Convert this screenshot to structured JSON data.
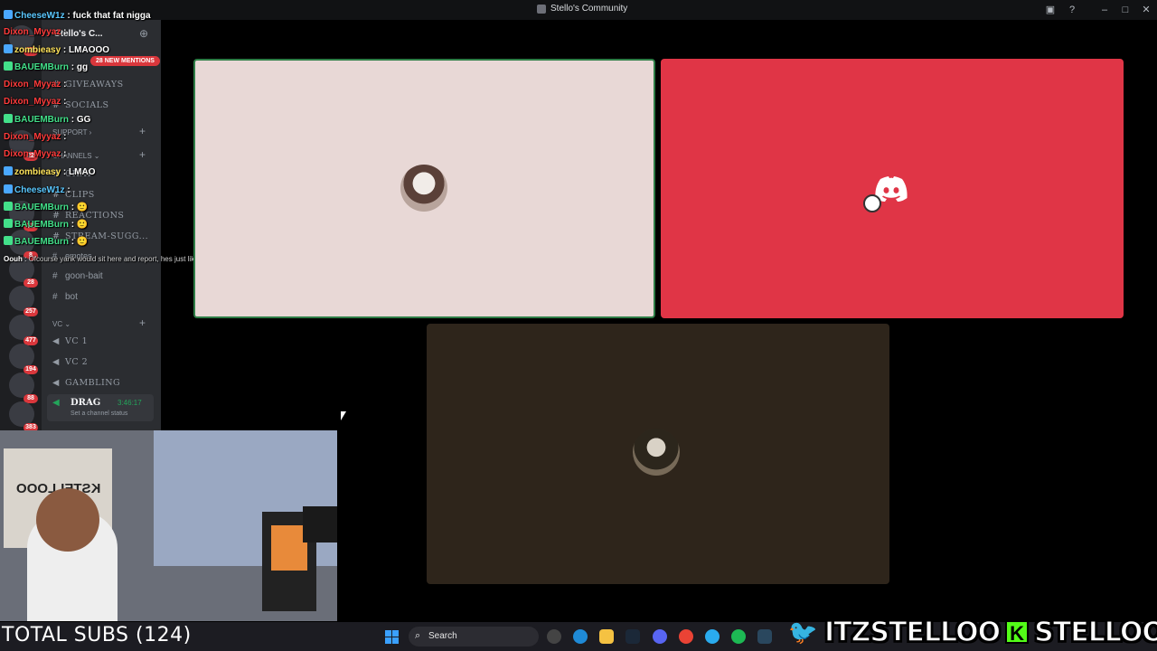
{
  "window": {
    "title": "Stello's Community"
  },
  "server": {
    "name": "Stello's C...",
    "mentions_badge": "28 NEW MENTIONS"
  },
  "guild_badges": [
    "54",
    "22",
    "72",
    "8",
    "28",
    "257",
    "477",
    "194",
    "88",
    "383"
  ],
  "channels": {
    "giveaways": "GIVEAWAYS",
    "socials": "SOCIALS",
    "support": "Support",
    "channels_cat": "Channels",
    "chat": "CHAT",
    "clips": "CLIPS",
    "reactions": "REACTIONS",
    "stream_sugg": "STREAM-SUGG...",
    "emotes": "emotes",
    "goon_bait": "goon-bait",
    "bot": "bot",
    "vc_cat": "VC",
    "vc1": "VC 1",
    "vc2": "VC 2",
    "gambling": "GAMBLING",
    "drag": "DRAG",
    "drag_time": "3:46:17",
    "drag_status": "Set a channel status"
  },
  "chat": [
    {
      "user": "CheeseW1z",
      "color": "#5ac8ff",
      "text": "fuck that fat nigga"
    },
    {
      "user": "Dixon_Myyaz",
      "color": "#ff3b3b",
      "text": ":"
    },
    {
      "user": "zombieasy",
      "color": "#ffe45c",
      "text": "LMAOOO"
    },
    {
      "user": "BAUEMBurn",
      "color": "#43e08a",
      "text": "gg"
    },
    {
      "user": "Dixon_Myyaz",
      "color": "#ff3b3b",
      "text": ":"
    },
    {
      "user": "Dixon_Myyaz",
      "color": "#ff3b3b",
      "text": ":"
    },
    {
      "user": "BAUEMBurn",
      "color": "#43e08a",
      "text": "GG"
    },
    {
      "user": "Dixon_Myyaz",
      "color": "#ff3b3b",
      "text": ":"
    },
    {
      "user": "Dixon_Myyaz",
      "color": "#ff3b3b",
      "text": ":"
    },
    {
      "user": "zombieasy",
      "color": "#ffe45c",
      "text": "LMAO"
    },
    {
      "user": "CheeseW1z",
      "color": "#5ac8ff",
      "text": ":"
    },
    {
      "user": "BAUEMBurn",
      "color": "#43e08a",
      "text": "🙂"
    },
    {
      "user": "BAUEMBurn",
      "color": "#43e08a",
      "text": "🙂"
    },
    {
      "user": "BAUEMBurn",
      "color": "#43e08a",
      "text": "🙂"
    },
    {
      "user": "Oouh",
      "color": "#ffffff",
      "text": "Ofcourse yank would sit here and report, hes just like varee"
    }
  ],
  "overlay": {
    "total_subs": "TOTAL SUBS (124)",
    "twitter_handle": "ITZSTELLOO",
    "kick_handle": "STELLOOO",
    "kick_letter": "K"
  },
  "taskbar": {
    "search_placeholder": "Search"
  },
  "colors": {
    "tile_speaking_border": "#2d7d46",
    "tile2_bg": "#e03546",
    "tile3_bg": "#2e251b"
  }
}
